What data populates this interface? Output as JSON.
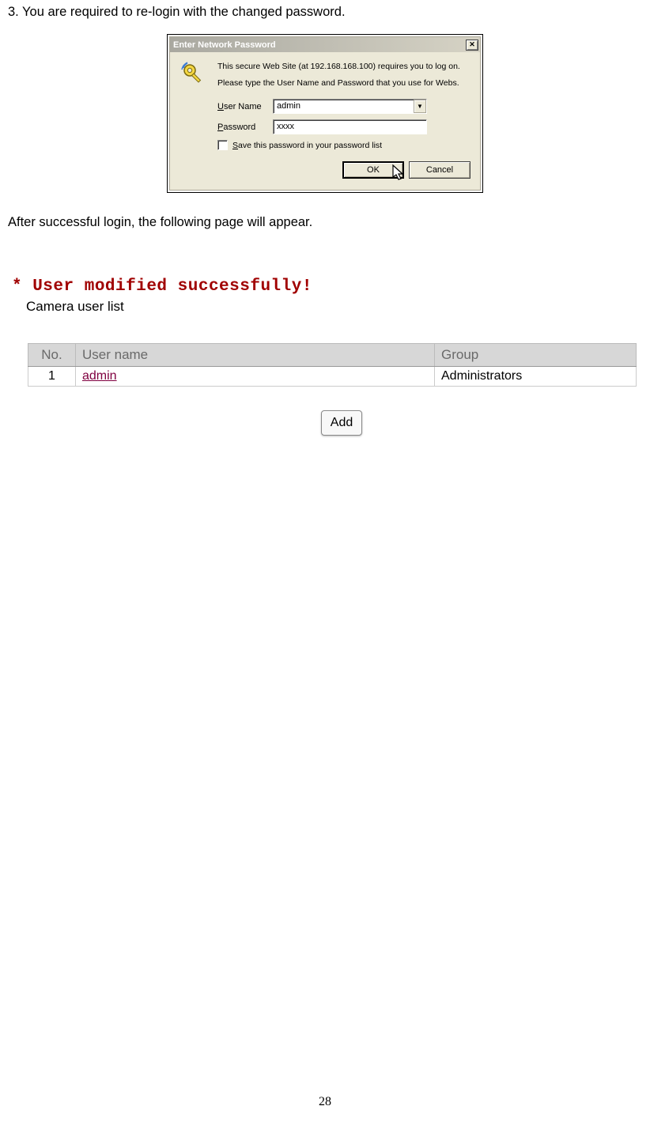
{
  "doc": {
    "instruction": "3. You are required to re-login with the changed password.",
    "followup": "After successful login, the following page will appear.",
    "page_number": "28"
  },
  "dialog": {
    "title": "Enter Network Password",
    "msg1": "This secure Web Site (at 192.168.168.100) requires you to log on.",
    "msg2": "Please type the User Name and Password that you use for Webs.",
    "user_label_u": "U",
    "user_label_rest": "ser Name",
    "pass_label_u": "P",
    "pass_label_rest": "assword",
    "user_value": "admin",
    "pass_value": "xxxx",
    "save_u": "S",
    "save_rest": "ave this password in your password list",
    "ok": "OK",
    "cancel": "Cancel"
  },
  "success": {
    "message": "* User modified successfully!",
    "list_title": "Camera user list",
    "headers": {
      "no": "No.",
      "user": "User name",
      "group": "Group"
    },
    "rows": [
      {
        "no": "1",
        "user": "admin",
        "group": "Administrators"
      }
    ],
    "add_label": "Add"
  }
}
